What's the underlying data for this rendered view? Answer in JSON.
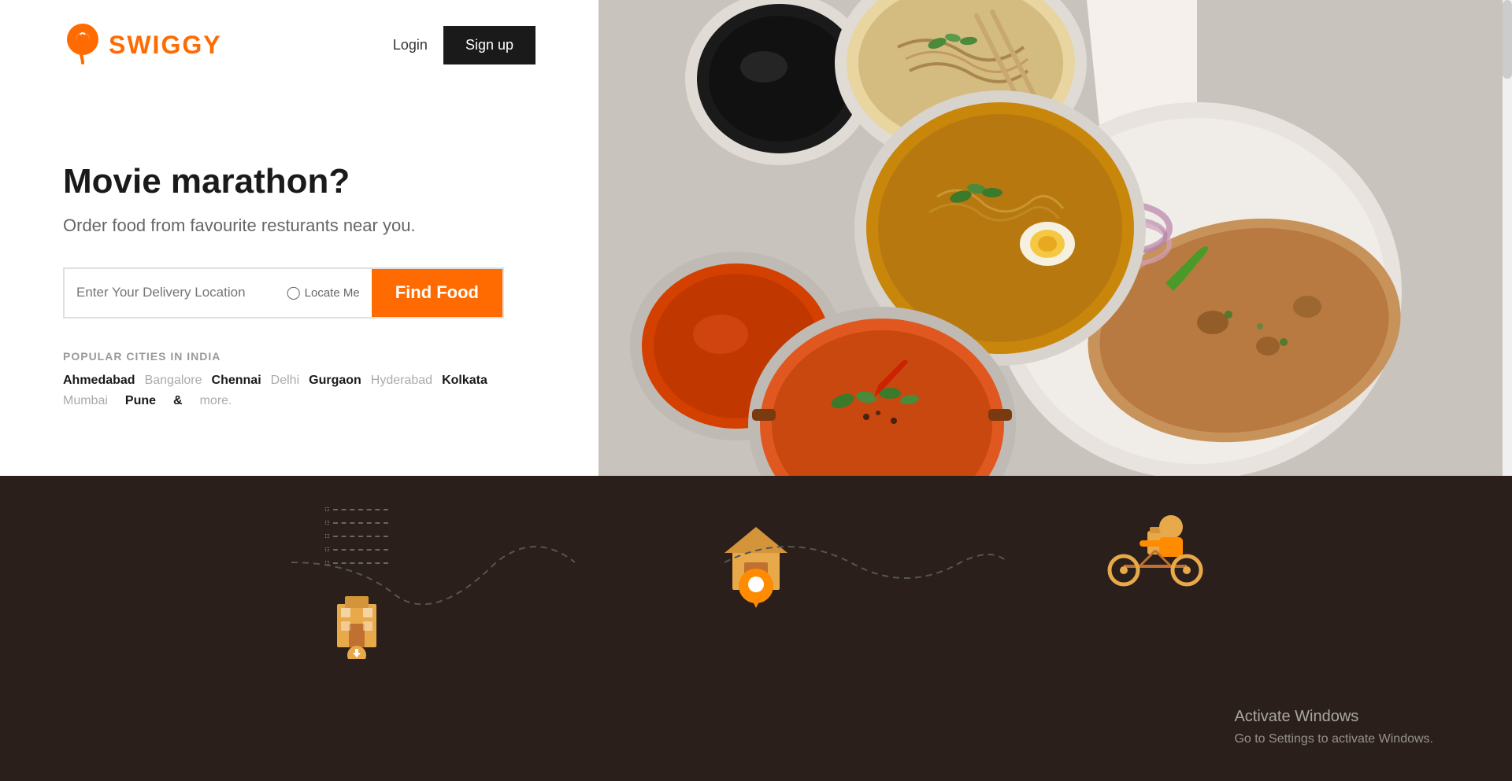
{
  "brand": {
    "name": "SWIGGY",
    "logo_text": "SWIGGY",
    "accent_color": "#ff6b00",
    "dark_color": "#1a1a1a"
  },
  "header": {
    "login_label": "Login",
    "signup_label": "Sign up"
  },
  "hero": {
    "title": "Movie marathon?",
    "subtitle": "Order food from favourite resturants near you."
  },
  "search": {
    "placeholder": "Enter Your Delivery Location",
    "locate_me_label": "Locate Me",
    "find_food_label": "Find Food"
  },
  "popular_cities": {
    "heading": "POPULAR CITIES IN INDIA",
    "cities_row1": [
      {
        "label": "Ahmedabad",
        "muted": false
      },
      {
        "label": "Bangalore",
        "muted": true
      },
      {
        "label": "Chennai",
        "muted": false
      },
      {
        "label": "Delhi",
        "muted": true
      },
      {
        "label": "Gurgaon",
        "muted": false
      },
      {
        "label": "Hyderabad",
        "muted": true
      },
      {
        "label": "Kolkata",
        "muted": false
      }
    ],
    "cities_row2": [
      {
        "label": "Mumbai",
        "muted": true
      },
      {
        "label": "Pune",
        "muted": false
      },
      {
        "label": "&",
        "muted": false
      },
      {
        "label": "more.",
        "muted": true
      }
    ]
  },
  "bottom_section": {
    "activate_windows_title": "Activate Windows",
    "activate_windows_subtitle": "Go to Settings to activate Windows."
  },
  "scrollbar": {
    "visible": true
  }
}
